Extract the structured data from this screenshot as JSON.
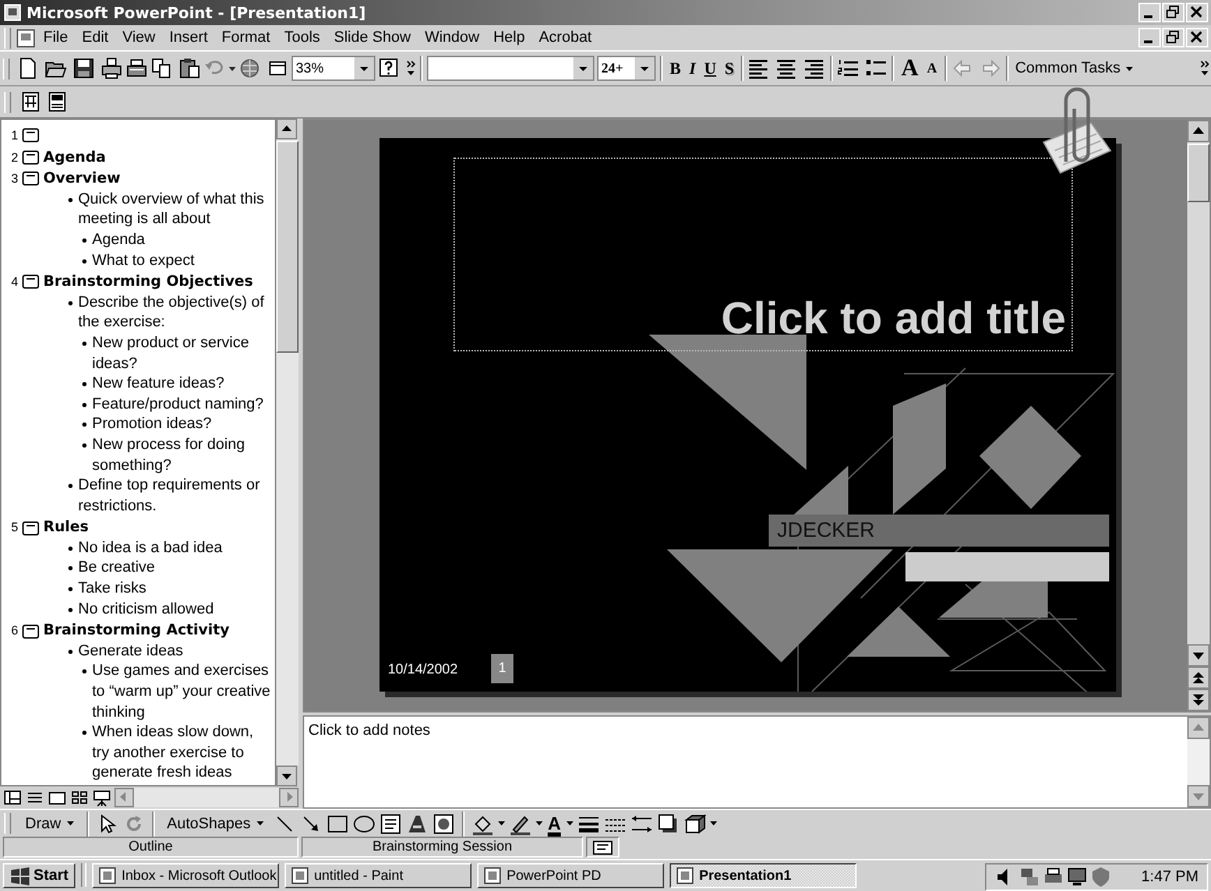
{
  "window": {
    "title": "Microsoft PowerPoint - [Presentation1]"
  },
  "menu": [
    "File",
    "Edit",
    "View",
    "Insert",
    "Format",
    "Tools",
    "Slide Show",
    "Window",
    "Help",
    "Acrobat"
  ],
  "toolbar": {
    "zoom": "33%",
    "font_size": "24+",
    "format_buttons": [
      "B",
      "I",
      "U",
      "S"
    ],
    "font_size_buttons": [
      "A",
      "A"
    ],
    "common_tasks": "Common Tasks"
  },
  "outline": {
    "slides": [
      {
        "number": "1"
      },
      {
        "number": "2",
        "title": "Agenda"
      },
      {
        "number": "3",
        "title": "Overview",
        "children": [
          {
            "text": "Quick overview of what this meeting is all about",
            "children": [
              {
                "text": "Agenda"
              },
              {
                "text": "What to expect"
              }
            ]
          }
        ]
      },
      {
        "number": "4",
        "title": "Brainstorming Objectives",
        "children": [
          {
            "text": "Describe the objective(s) of the exercise:",
            "children": [
              {
                "text": "New product or service ideas?"
              },
              {
                "text": "New feature ideas?"
              },
              {
                "text": "Feature/product naming?"
              },
              {
                "text": "Promotion ideas?"
              },
              {
                "text": "New process for doing something?"
              }
            ]
          },
          {
            "text": "Define top requirements or restrictions."
          }
        ]
      },
      {
        "number": "5",
        "title": "Rules",
        "children": [
          {
            "text": "No idea is a bad idea"
          },
          {
            "text": "Be creative"
          },
          {
            "text": "Take risks"
          },
          {
            "text": "No criticism allowed"
          }
        ]
      },
      {
        "number": "6",
        "title": "Brainstorming Activity",
        "children": [
          {
            "text": "Generate ideas",
            "children": [
              {
                "text": "Use games and exercises to “warm up” your creative thinking"
              },
              {
                "text": "When ideas slow down, try another exercise to generate fresh ideas"
              }
            ]
          }
        ]
      }
    ]
  },
  "slide": {
    "title_prompt": "Click to add title",
    "subtitle": "JDECKER",
    "date": "10/14/2002",
    "number": "1"
  },
  "notes": {
    "prompt": "Click to add notes"
  },
  "drawing_toolbar": {
    "draw": "Draw",
    "autoshapes": "AutoShapes",
    "font_color_button": "A"
  },
  "status_bar": [
    "Outline",
    "Brainstorming Session"
  ],
  "taskbar": {
    "start": "Start",
    "items": [
      {
        "label": "Inbox - Microsoft Outlook",
        "selected": false
      },
      {
        "label": "untitled - Paint",
        "selected": false
      },
      {
        "label": "PowerPoint PD",
        "selected": false
      },
      {
        "label": "Presentation1",
        "selected": true
      }
    ],
    "clock": "1:47 PM"
  }
}
